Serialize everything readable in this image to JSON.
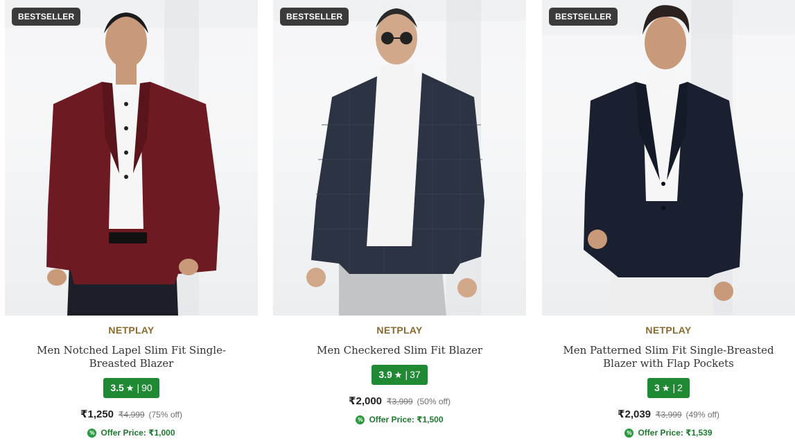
{
  "products": [
    {
      "badge": "BESTSELLER",
      "brand": "NETPLAY",
      "title": "Men Notched Lapel Slim Fit Single-Breasted Blazer",
      "rating": "3.5",
      "rating_icon": "star-icon",
      "rating_separator": "|",
      "review_count": "90",
      "price": "₹1,250",
      "mrp": "₹4,999",
      "discount": "(75% off)",
      "offer_price": "Offer Price: ₹1,000",
      "jacket_color": "#6e1a22",
      "shirt_color": "#f6f6f6",
      "pants_color": "#1c1f28"
    },
    {
      "badge": "BESTSELLER",
      "brand": "NETPLAY",
      "title": "Men Checkered Slim Fit Blazer",
      "rating": "3.9",
      "rating_icon": "star-icon",
      "rating_separator": "|",
      "review_count": "37",
      "price": "₹2,000",
      "mrp": "₹3,999",
      "discount": "(50% off)",
      "offer_price": "Offer Price: ₹1,500",
      "jacket_color": "#2c3342",
      "shirt_color": "#f4f4f4",
      "pants_color": "#c3c4c6"
    },
    {
      "badge": "BESTSELLER",
      "brand": "NETPLAY",
      "title": "Men Patterned Slim Fit Single-Breasted Blazer with Flap Pockets",
      "rating": "3",
      "rating_icon": "star-icon",
      "rating_separator": "|",
      "review_count": "2",
      "price": "₹2,039",
      "mrp": "₹3,999",
      "discount": "(49% off)",
      "offer_price": "Offer Price: ₹1,539",
      "jacket_color": "#1a2030",
      "shirt_color": "#f6f6f6",
      "pants_color": "#eeeeee"
    }
  ],
  "colors": {
    "brand_text": "#8a6a2c",
    "rating_bg": "#1f8a33",
    "offer_text": "#1d7a2f",
    "badge_bg": "#3b3b3b"
  }
}
